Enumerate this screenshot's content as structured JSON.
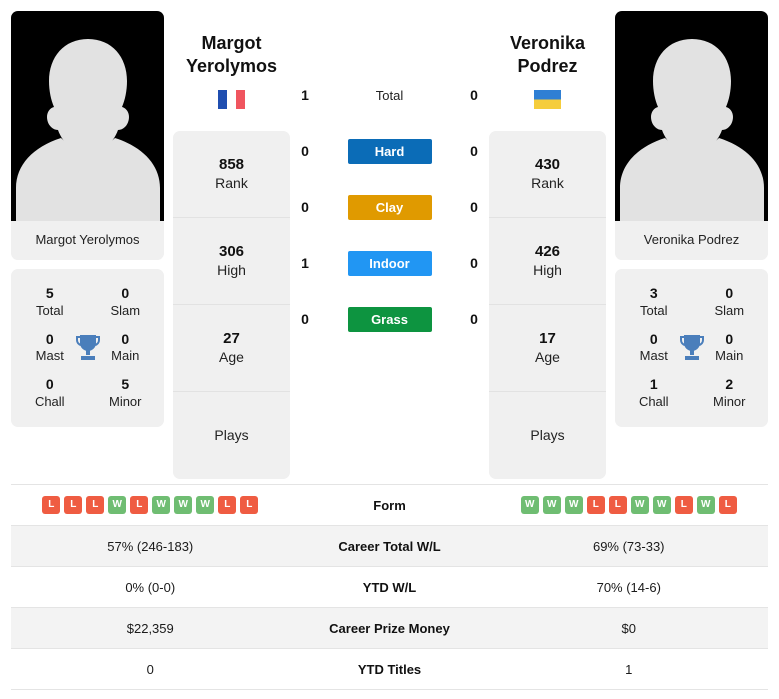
{
  "players": {
    "left": {
      "name_line1": "Margot",
      "name_line2": "Yerolymos",
      "full_name": "Margot Yerolymos",
      "photo_caption": "Margot Yerolymos",
      "flag": "france-flag",
      "rank": "858",
      "rank_label": "Rank",
      "high": "306",
      "high_label": "High",
      "age": "27",
      "age_label": "Age",
      "plays": "",
      "plays_label": "Plays",
      "titles": {
        "total": "5",
        "total_label": "Total",
        "slam": "0",
        "slam_label": "Slam",
        "mast": "0",
        "mast_label": "Mast",
        "main": "0",
        "main_label": "Main",
        "chall": "0",
        "chall_label": "Chall",
        "minor": "5",
        "minor_label": "Minor"
      },
      "form": [
        "L",
        "L",
        "L",
        "W",
        "L",
        "W",
        "W",
        "W",
        "L",
        "L"
      ],
      "career_wl": "57% (246-183)",
      "ytd_wl": "0% (0-0)",
      "prize_money": "$22,359",
      "ytd_titles": "0"
    },
    "right": {
      "name_line1": "Veronika",
      "name_line2": "Podrez",
      "full_name": "Veronika Podrez",
      "photo_caption": "Veronika Podrez",
      "flag": "ukraine-flag",
      "rank": "430",
      "rank_label": "Rank",
      "high": "426",
      "high_label": "High",
      "age": "17",
      "age_label": "Age",
      "plays": "",
      "plays_label": "Plays",
      "titles": {
        "total": "3",
        "total_label": "Total",
        "slam": "0",
        "slam_label": "Slam",
        "mast": "0",
        "mast_label": "Mast",
        "main": "0",
        "main_label": "Main",
        "chall": "1",
        "chall_label": "Chall",
        "minor": "2",
        "minor_label": "Minor"
      },
      "form": [
        "W",
        "W",
        "W",
        "L",
        "L",
        "W",
        "W",
        "L",
        "W",
        "L"
      ],
      "career_wl": "69% (73-33)",
      "ytd_wl": "70% (14-6)",
      "prize_money": "$0",
      "ytd_titles": "1"
    }
  },
  "h2h": {
    "rows": [
      {
        "label": "Total",
        "left": "1",
        "right": "0",
        "type": "text"
      },
      {
        "label": "Hard",
        "left": "0",
        "right": "0",
        "type": "badge",
        "color": "#0b6cb7"
      },
      {
        "label": "Clay",
        "left": "0",
        "right": "0",
        "type": "badge",
        "color": "#e09a00"
      },
      {
        "label": "Indoor",
        "left": "1",
        "right": "0",
        "type": "badge",
        "color": "#2196f3"
      },
      {
        "label": "Grass",
        "left": "0",
        "right": "0",
        "type": "badge",
        "color": "#0d9440"
      }
    ]
  },
  "table": {
    "rows": [
      {
        "label": "Form",
        "key": "form",
        "kind": "form",
        "shaded": false
      },
      {
        "label": "Career Total W/L",
        "key": "career_wl",
        "kind": "text",
        "shaded": true
      },
      {
        "label": "YTD W/L",
        "key": "ytd_wl",
        "kind": "text",
        "shaded": false
      },
      {
        "label": "Career Prize Money",
        "key": "prize_money",
        "kind": "text",
        "shaded": true
      },
      {
        "label": "YTD Titles",
        "key": "ytd_titles",
        "kind": "text",
        "shaded": false
      }
    ]
  },
  "colors": {
    "hard": "#0b6cb7",
    "clay": "#e09a00",
    "indoor": "#2196f3",
    "grass": "#0d9440",
    "win": "#6fbd72",
    "loss": "#ef5c42",
    "trophy": "#4a7ebb"
  }
}
